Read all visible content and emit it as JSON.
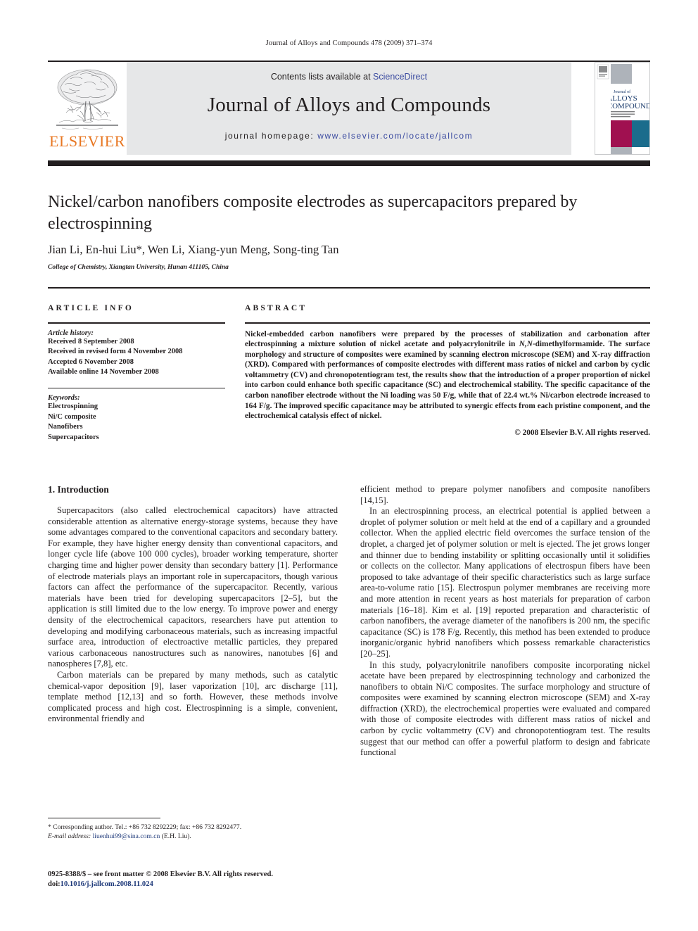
{
  "running_head": "Journal of Alloys and Compounds 478 (2009) 371–374",
  "masthead": {
    "contents_prefix": "Contents lists available at ",
    "sciencedirect": "ScienceDirect",
    "journal_name": "Journal of Alloys and Compounds",
    "homepage_prefix": "journal homepage: ",
    "homepage_url": "www.elsevier.com/locate/jallcom",
    "publisher": "ELSEVIER",
    "publisher_color": "#E87722",
    "cover_title_small": "Journal of",
    "cover_title_line1": "ALLOYS",
    "cover_title_line2": "AND COMPOUNDS",
    "cover_magenta": "#A01050",
    "cover_teal": "#1B6C8C",
    "cover_grey": "#AEB3BA",
    "link_color": "#3b4ba0"
  },
  "article": {
    "title": "Nickel/carbon nanofibers composite electrodes as supercapacitors prepared by electrospinning",
    "authors": "Jian Li, En-hui Liu*, Wen Li, Xiang-yun Meng, Song-ting Tan",
    "affiliation": "College of Chemistry, Xiangtan University, Hunan 411105, China"
  },
  "article_info": {
    "heading": "ARTICLE INFO",
    "history_label": "Article history:",
    "history": [
      "Received 8 September 2008",
      "Received in revised form 4 November 2008",
      "Accepted 6 November 2008",
      "Available online 14 November 2008"
    ],
    "keywords_label": "Keywords:",
    "keywords": [
      "Electrospinning",
      "Ni/C composite",
      "Nanofibers",
      "Supercapacitors"
    ]
  },
  "abstract": {
    "heading": "ABSTRACT",
    "text_part1": "Nickel-embedded carbon nanofibers were prepared by the processes of stabilization and carbonation after electrospinning a mixture solution of nickel acetate and polyacrylonitrile in ",
    "text_italic": "N,N",
    "text_part2": "-dimethylformamide. The surface morphology and structure of composites were examined by scanning electron microscope (SEM) and X-ray diffraction (XRD). Compared with performances of composite electrodes with different mass ratios of nickel and carbon by cyclic voltammetry (CV) and chronopotentiogram test, the results show that the introduction of a proper proportion of nickel into carbon could enhance both specific capacitance (SC) and electrochemical stability. The specific capacitance of the carbon nanofiber electrode without the Ni loading was 50 F/g, while that of 22.4 wt.% Ni/carbon electrode increased to 164 F/g. The improved specific capacitance may be attributed to synergic effects from each pristine component, and the electrochemical catalysis effect of nickel.",
    "copyright": "© 2008 Elsevier B.V. All rights reserved."
  },
  "body": {
    "section_title": "1.  Introduction",
    "left_paragraphs": [
      "Supercapacitors (also called electrochemical capacitors) have attracted considerable attention as alternative energy-storage systems, because they have some advantages compared to the conventional capacitors and secondary battery. For example, they have higher energy density than conventional capacitors, and longer cycle life (above 100 000 cycles), broader working temperature, shorter charging time and higher power density than secondary battery [1]. Performance of electrode materials plays an important role in supercapacitors, though various factors can affect the performance of the supercapacitor. Recently, various materials have been tried for developing supercapacitors [2–5], but the application is still limited due to the low energy. To improve power and energy density of the electrochemical capacitors, researchers have put attention to developing and modifying carbonaceous materials, such as increasing impactful surface area, introduction of electroactive metallic particles, they prepared various carbonaceous nanostructures such as nanowires, nanotubes [6] and nanospheres [7,8], etc.",
      "Carbon materials can be prepared by many methods, such as catalytic chemical-vapor deposition [9], laser vaporization [10], arc discharge [11], template method [12,13] and so forth. However, these methods involve complicated process and high cost. Electrospinning is a simple, convenient, environmental friendly and"
    ],
    "right_paragraphs": [
      "efficient method to prepare polymer nanofibers and composite nanofibers [14,15].",
      "In an electrospinning process, an electrical potential is applied between a droplet of polymer solution or melt held at the end of a capillary and a grounded collector. When the applied electric field overcomes the surface tension of the droplet, a charged jet of polymer solution or melt is ejected. The jet grows longer and thinner due to bending instability or splitting occasionally until it solidifies or collects on the collector. Many applications of electrospun fibers have been proposed to take advantage of their specific characteristics such as large surface area-to-volume ratio [15]. Electrospun polymer membranes are receiving more and more attention in recent years as host materials for preparation of carbon materials [16–18]. Kim et al. [19] reported preparation and characteristic of carbon nanofibers, the average diameter of the nanofibers is 200 nm, the specific capacitance (SC) is 178 F/g. Recently, this method has been extended to produce inorganic/organic hybrid nanofibers which possess remarkable characteristics [20–25].",
      "In this study, polyacrylonitrile nanofibers composite incorporating nickel acetate have been prepared by electrospinning technology and carbonized the nanofibers to obtain Ni/C composites. The surface morphology and structure of composites were examined by scanning electron microscope (SEM) and X-ray diffraction (XRD), the electrochemical properties were evaluated and compared with those of composite electrodes with different mass ratios of nickel and carbon by cyclic voltammetry (CV) and chronopotentiogram test. The results suggest that our method can offer a powerful platform to design and fabricate functional"
    ]
  },
  "footnote": {
    "corresponding": "*  Corresponding author. Tel.: +86 732 8292229; fax: +86 732 8292477.",
    "email_label": "E-mail address:",
    "email": "liuenhui99@sina.com.cn",
    "email_suffix": " (E.H. Liu)."
  },
  "imprint": {
    "line1": "0925-8388/$ – see front matter © 2008 Elsevier B.V. All rights reserved.",
    "doi_label": "doi:",
    "doi_value": "10.1016/j.jallcom.2008.11.024"
  }
}
